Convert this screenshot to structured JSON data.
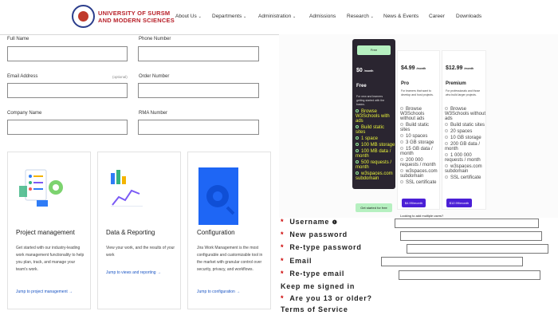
{
  "header": {
    "logo_line1": "UNIVERSITY OF SURSM",
    "logo_line2": "AND MODERN SCIENCES",
    "nav": [
      {
        "label": "About Us",
        "chevron": true
      },
      {
        "label": "Departments",
        "chevron": true
      },
      {
        "label": "Administration",
        "chevron": true
      },
      {
        "label": "Admissions",
        "chevron": false
      },
      {
        "label": "Research",
        "chevron": true
      },
      {
        "label": "News & Events",
        "chevron": false
      },
      {
        "label": "Career",
        "chevron": false
      },
      {
        "label": "Downloads",
        "chevron": false
      }
    ]
  },
  "form": {
    "full_name": "Full Name",
    "phone_number": "Phone Number",
    "email_address": "Email Address",
    "optional": "(optional)",
    "order_number": "Order Number",
    "company_name": "Company Name",
    "rma_number": "RMA Number"
  },
  "cards": [
    {
      "title": "Project management",
      "text": "Get started with our industry-leading work management functionality to help you plan, track, and manage your team's work.",
      "link": "Jump to project management →"
    },
    {
      "title": "Data & Reporting",
      "text": "View your work, and the results of your work",
      "link": "Jump to views and reporting →"
    },
    {
      "title": "Configuration",
      "text": "Jira Work Management is the most configurable and customizable tool in the market with granular control over security, privacy, and workflows.",
      "link": "Jump to configuration →"
    }
  ],
  "pricing": {
    "top_button": "Free",
    "plans": [
      {
        "price": "$0",
        "per": "/month",
        "name": "Free",
        "desc": "For new and learners getting started with the basics.",
        "features": [
          "Browse W3Schools with ads",
          "Build static sites",
          "1 space",
          "100 MB storage",
          "100 MB data / month",
          "500 requests / month",
          "w3spaces.com subdomain"
        ],
        "button": "Get started for free"
      },
      {
        "price": "$4.99",
        "per": "/month",
        "name": "Pro",
        "desc": "For learners that want to develop and host projects.",
        "features": [
          "Browse W3Schools without ads",
          "Build static sites",
          "10 spaces",
          "3 GB storage",
          "15 GB data / month",
          "200 000 requests / month",
          "w3spaces.com subdomain",
          "SSL certificate"
        ],
        "button": "$4.99/month"
      },
      {
        "price": "$12.99",
        "per": "/month",
        "name": "Premium",
        "desc": "For professionals and those who build larger projects.",
        "features": [
          "Browse W3Schools without ads",
          "Build static sites",
          "20 spaces",
          "10 GB storage",
          "200 GB data / month",
          "1 000 000 requests / month",
          "w3spaces.com subdomain",
          "SSL certificate"
        ],
        "button": "$12.99/month"
      }
    ],
    "footnote": "Looking to add multiple users?"
  },
  "registration": {
    "username": "Username",
    "new_password": "New password",
    "retype_password": "Re-type password",
    "email": "Email",
    "retype_email": "Re-type email",
    "keep_signed_in": "Keep me signed in",
    "age_question": "Are you 13 or older?",
    "terms": "Terms of Service"
  },
  "colors": {
    "brand_red": "#b8212a",
    "brand_blue": "#2c3e8c",
    "plan_dark": "#2a2530",
    "accent_green": "#b6f0c0",
    "accent_purple": "#4b1fd6",
    "feature_yellow": "#e7f13a"
  }
}
